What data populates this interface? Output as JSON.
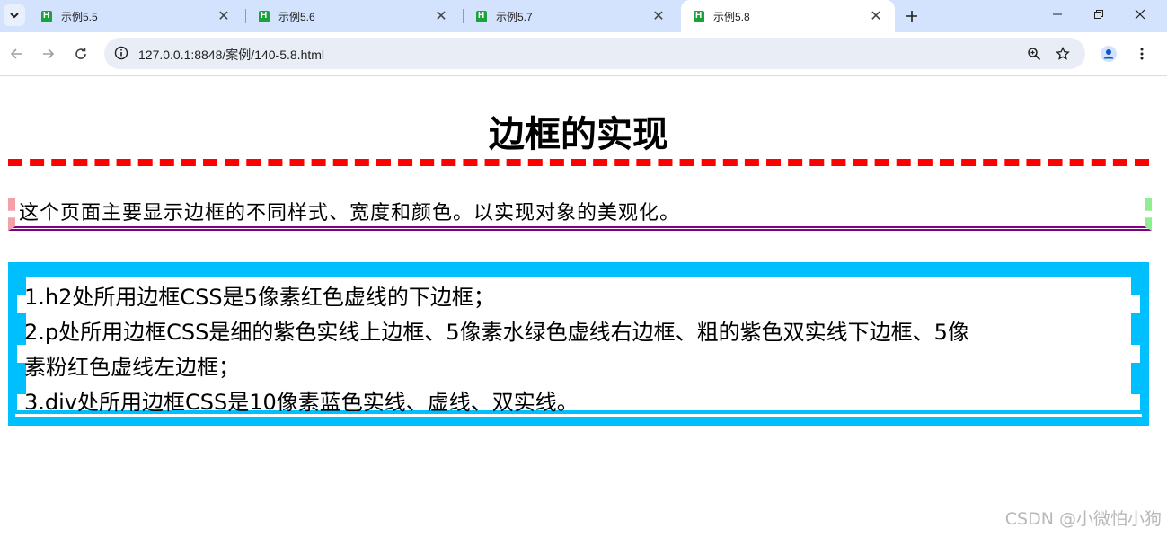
{
  "browser": {
    "tabs": [
      {
        "title": "示例5.5",
        "active": false
      },
      {
        "title": "示例5.6",
        "active": false
      },
      {
        "title": "示例5.7",
        "active": false
      },
      {
        "title": "示例5.8",
        "active": true
      }
    ],
    "url": "127.0.0.1:8848/案例/140-5.8.html"
  },
  "page": {
    "heading": "边框的实现",
    "intro": "这个页面主要显示边框的不同样式、宽度和颜色。以实现对象的美观化。",
    "notes": [
      "1.h2处所用边框CSS是5像素红色虚线的下边框；",
      "2.p处所用边框CSS是细的紫色实线上边框、5像素水绿色虚线右边框、粗的紫色双实线下边框、5像",
      "素粉红色虚线左边框；",
      "3.div处所用边框CSS是10像素蓝色实线、虚线、双实线。"
    ]
  },
  "watermark": "CSDN @小微怕小狗",
  "colors": {
    "tabstrip": "#d3e3fd",
    "heading_border": "#ff0000",
    "p_top": "#8b008b",
    "p_right": "#90ee90",
    "p_bottom": "#800080",
    "p_left": "#f4a0a8",
    "div_border": "#00bfff"
  }
}
